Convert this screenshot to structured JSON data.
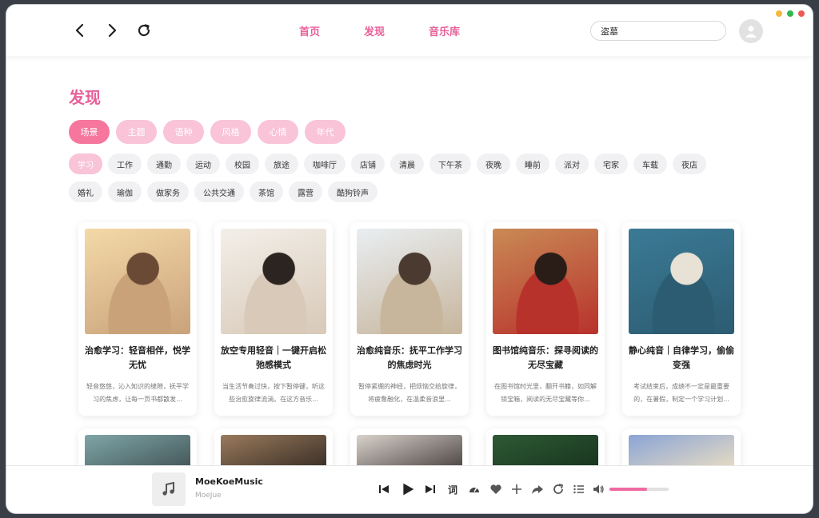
{
  "window": {
    "controls": [
      {
        "name": "minimize",
        "color": "#f5b83d"
      },
      {
        "name": "maximize",
        "color": "#2fb84d"
      },
      {
        "name": "close",
        "color": "#ee5a52"
      }
    ]
  },
  "header": {
    "nav": {
      "back_icon": "chevron-left",
      "forward_icon": "chevron-right",
      "refresh_icon": "refresh"
    },
    "tabs": [
      {
        "label": "首页"
      },
      {
        "label": "发现"
      },
      {
        "label": "音乐库"
      }
    ],
    "search": {
      "value": "盗墓"
    },
    "avatar_icon": "user"
  },
  "page": {
    "title": "发现",
    "accent_color": "#e8609a",
    "categories": [
      {
        "label": "场景",
        "active": true
      },
      {
        "label": "主题",
        "active": false
      },
      {
        "label": "语种",
        "active": false
      },
      {
        "label": "风格",
        "active": false
      },
      {
        "label": "心情",
        "active": false
      },
      {
        "label": "年代",
        "active": false
      }
    ],
    "tags": [
      {
        "label": "学习",
        "active": true
      },
      {
        "label": "工作"
      },
      {
        "label": "通勤"
      },
      {
        "label": "运动"
      },
      {
        "label": "校园"
      },
      {
        "label": "旅途"
      },
      {
        "label": "咖啡厅"
      },
      {
        "label": "店铺"
      },
      {
        "label": "清晨"
      },
      {
        "label": "下午茶"
      },
      {
        "label": "夜晚"
      },
      {
        "label": "睡前"
      },
      {
        "label": "派对"
      },
      {
        "label": "宅家"
      },
      {
        "label": "车载"
      },
      {
        "label": "夜店"
      },
      {
        "label": "婚礼"
      },
      {
        "label": "瑜伽"
      },
      {
        "label": "做家务"
      },
      {
        "label": "公共交通"
      },
      {
        "label": "茶馆"
      },
      {
        "label": "露营"
      },
      {
        "label": "酷狗铃声"
      }
    ],
    "playlists": [
      {
        "title": "治愈学习：轻音相伴，悦学无忧",
        "desc": "轻音悠悠，沁入知识的缝隙，抚平学习的焦虑，让每一页书都散发...",
        "colors": [
          "#f4d9a8",
          "#c9a27a",
          "#6b4a35"
        ]
      },
      {
        "title": "放空专用轻音｜一键开启松弛感模式",
        "desc": "当生活节奏过快，按下暂停键，听这些治愈旋律流淌。在这方音乐...",
        "colors": [
          "#f3efe9",
          "#d8c9b8",
          "#2b2420"
        ]
      },
      {
        "title": "治愈纯音乐：抚平工作学习的焦虑时光",
        "desc": "暂停紧绷的神经，把烦恼交给旋律，将疲惫融化，在温柔音浪里...",
        "colors": [
          "#e9eef2",
          "#c7b59c",
          "#4a3a30"
        ]
      },
      {
        "title": "图书馆纯音乐：探寻阅读的无尽宝藏",
        "desc": "在图书馆时光里，翻开书籍，如同解锁宝箱，阅读的无尽宝藏等你...",
        "colors": [
          "#c98a55",
          "#b8322c",
          "#2a1d18"
        ]
      },
      {
        "title": "静心纯音｜自律学习，偷偷变强",
        "desc": "考试结束后，成绩不一定是最重要的，在暑假，制定一个学习计划...",
        "colors": [
          "#3b7a95",
          "#2c5c72",
          "#e8e2d6"
        ]
      }
    ],
    "more_playlists": [
      {
        "colors": [
          "#7fa6a8",
          "#3d4d4f"
        ]
      },
      {
        "colors": [
          "#9a7a5c",
          "#2e2620"
        ]
      },
      {
        "colors": [
          "#d9d2cc",
          "#3c3533"
        ]
      },
      {
        "colors": [
          "#2e5a35",
          "#16301c"
        ]
      },
      {
        "colors": [
          "#8aa4d6",
          "#f2e2c0"
        ]
      }
    ]
  },
  "player": {
    "song_title": "MoeKoeMusic",
    "artist": "MoeJue",
    "thumb_icon": "music-note",
    "lyrics_label": "词",
    "volume": 0.64,
    "volume_color": "#f06aa1"
  }
}
